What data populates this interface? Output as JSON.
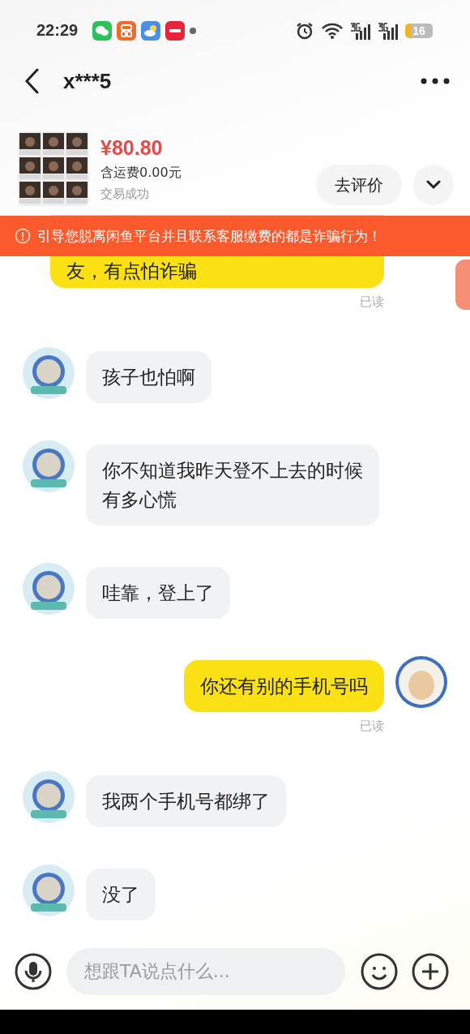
{
  "status_bar": {
    "time": "22:29",
    "battery": "16"
  },
  "header": {
    "title": "x***5"
  },
  "product": {
    "price": "¥80.80",
    "shipping": "含运费0.00元",
    "status": "交易成功",
    "action": "去评价"
  },
  "warning": {
    "text": "引导您脱离闲鱼平台并且联系客服缴费的都是诈骗行为！"
  },
  "messages": [
    {
      "kind": "self",
      "text": "友，有点怕诈骗",
      "read": "已读",
      "cut": true
    },
    {
      "kind": "other",
      "text": "孩子也怕啊"
    },
    {
      "kind": "other",
      "text": "你不知道我昨天登不上去的时候有多心慌"
    },
    {
      "kind": "other",
      "text": "哇靠，登上了"
    },
    {
      "kind": "self",
      "text": "你还有别的手机号吗",
      "read": "已读"
    },
    {
      "kind": "other",
      "text": "我两个手机号都绑了"
    },
    {
      "kind": "other",
      "text": "没了"
    }
  ],
  "input": {
    "placeholder": "想跟TA说点什么..."
  }
}
